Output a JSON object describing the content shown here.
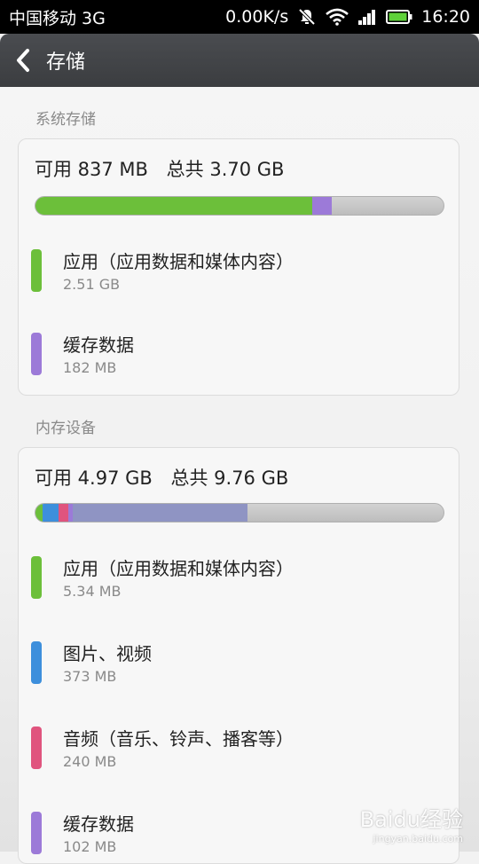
{
  "status_bar": {
    "carrier": "中国移动 3G",
    "speed": "0.00K/s",
    "time": "16:20"
  },
  "header": {
    "title": "存储",
    "back_icon": "chevron-left-icon"
  },
  "colors": {
    "app": "#6cbf3a",
    "cache": "#9c7ad8",
    "pictures": "#3d8fdc",
    "audio": "#e0547e",
    "other": "#8f94c3",
    "free": "#c4c4c4"
  },
  "system_storage": {
    "label": "系统存储",
    "available": "可用 837 MB",
    "total": "总共 3.70 GB",
    "bar": [
      {
        "key": "app",
        "fraction": 0.678
      },
      {
        "key": "cache",
        "fraction": 0.048
      }
    ],
    "items": [
      {
        "name": "应用（应用数据和媒体内容）",
        "size": "2.51 GB",
        "color_key": "app"
      },
      {
        "name": "缓存数据",
        "size": "182 MB",
        "color_key": "cache"
      }
    ]
  },
  "internal_storage": {
    "label": "内存设备",
    "available": "可用 4.97 GB",
    "total": "总共 9.76 GB",
    "bar": [
      {
        "key": "app",
        "fraction": 0.018
      },
      {
        "key": "pictures",
        "fraction": 0.038
      },
      {
        "key": "audio",
        "fraction": 0.024
      },
      {
        "key": "cache",
        "fraction": 0.012
      },
      {
        "key": "other",
        "fraction": 0.428
      }
    ],
    "items": [
      {
        "name": "应用（应用数据和媒体内容）",
        "size": "5.34 MB",
        "color_key": "app"
      },
      {
        "name": "图片、视频",
        "size": "373 MB",
        "color_key": "pictures"
      },
      {
        "name": "音频（音乐、铃声、播客等）",
        "size": "240 MB",
        "color_key": "audio"
      },
      {
        "name": "缓存数据",
        "size": "102 MB",
        "color_key": "cache"
      }
    ]
  },
  "watermark": {
    "brand": "Baidu经验",
    "url": "jingyan.baidu.com"
  }
}
